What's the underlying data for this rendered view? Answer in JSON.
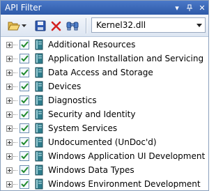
{
  "window": {
    "title": "API Filter",
    "buttons": {
      "dropdown_glyph": "▾",
      "pin_glyph": "ᐅ",
      "close_glyph": "✕"
    }
  },
  "toolbar": {
    "open_icon": "folder-open-icon",
    "save_icon": "save-icon",
    "delete_icon": "delete-icon",
    "find_icon": "find-icon",
    "module_combo": {
      "value": "Kernel32.dll"
    }
  },
  "tree": {
    "items": [
      {
        "label": "Additional Resources",
        "checked": true
      },
      {
        "label": "Application Installation and Servicing",
        "checked": true
      },
      {
        "label": "Data Access and Storage",
        "checked": true
      },
      {
        "label": "Devices",
        "checked": true
      },
      {
        "label": "Diagnostics",
        "checked": true
      },
      {
        "label": "Security and Identity",
        "checked": true
      },
      {
        "label": "System Services",
        "checked": true
      },
      {
        "label": "Undocumented (UnDoc'd)",
        "checked": true
      },
      {
        "label": "Windows Application UI Development",
        "checked": true
      },
      {
        "label": "Windows Data Types",
        "checked": true
      },
      {
        "label": "Windows Environment Development",
        "checked": true
      }
    ]
  },
  "colors": {
    "title_bar": "#3a67b8",
    "check": "#1f8a2a",
    "book": "#2f7d8c"
  }
}
